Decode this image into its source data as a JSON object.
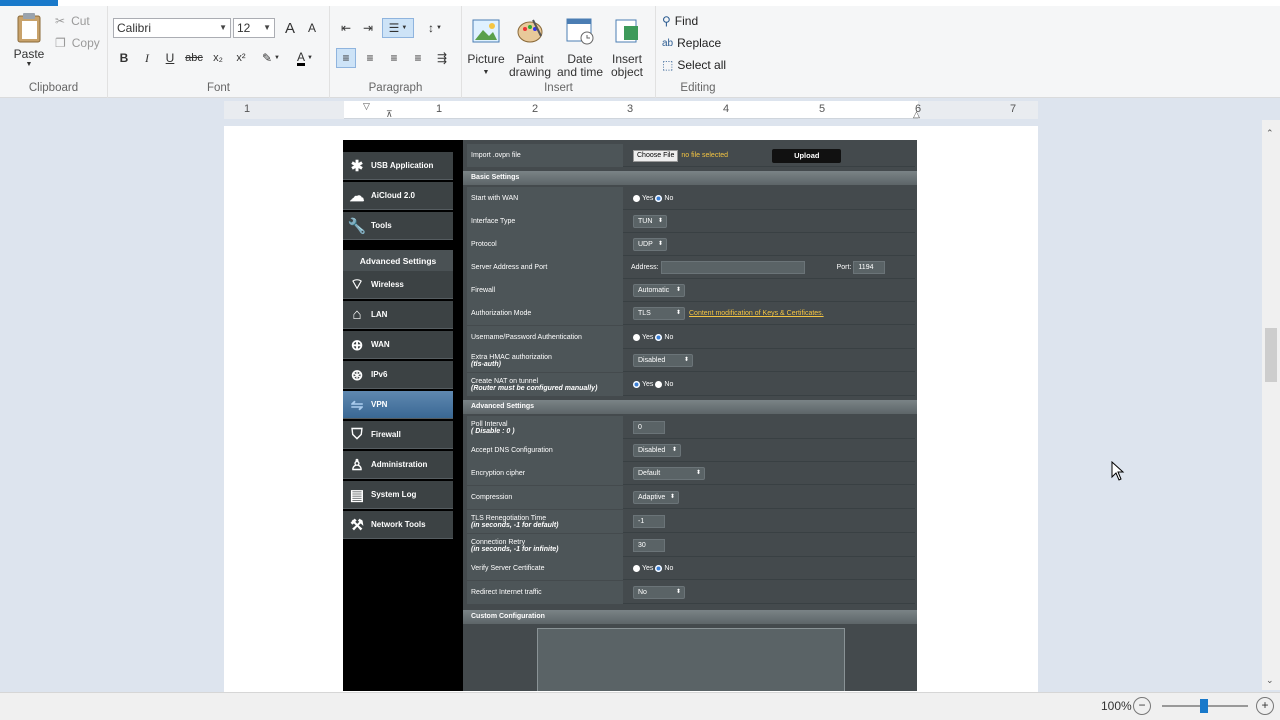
{
  "ribbon": {
    "clipboard": {
      "paste": "Paste",
      "cut": "Cut",
      "copy": "Copy",
      "label": "Clipboard"
    },
    "font": {
      "family": "Calibri",
      "size": "12",
      "label": "Font"
    },
    "paragraph": {
      "label": "Paragraph"
    },
    "insert": {
      "picture": "Picture",
      "paint": "Paint drawing",
      "datetime": "Date and time",
      "object": "Insert object",
      "label": "Insert"
    },
    "editing": {
      "find": "Find",
      "replace": "Replace",
      "selectall": "Select all",
      "label": "Editing"
    }
  },
  "ruler": {
    "numbers": [
      "1",
      "1",
      "2",
      "3",
      "4",
      "5",
      "6",
      "7"
    ]
  },
  "router": {
    "nav_top": [
      "USB Application",
      "AiCloud 2.0",
      "Tools"
    ],
    "adv_header": "Advanced Settings",
    "nav_adv": [
      "Wireless",
      "LAN",
      "WAN",
      "IPv6",
      "VPN",
      "Firewall",
      "Administration",
      "System Log",
      "Network Tools"
    ],
    "import": {
      "label": "Import .ovpn file",
      "choose": "Choose File",
      "nofile": "no file selected",
      "upload": "Upload"
    },
    "basic_header": "Basic Settings",
    "basic": [
      {
        "label": "Start with WAN",
        "yes": "Yes",
        "no": "No"
      },
      {
        "label": "Interface Type",
        "value": "TUN"
      },
      {
        "label": "Protocol",
        "value": "UDP"
      },
      {
        "label": "Server Address and Port",
        "address": "Address:",
        "port": "Port:",
        "port_value": "1194"
      },
      {
        "label": "Firewall",
        "value": "Automatic"
      },
      {
        "label": "Authorization Mode",
        "value": "TLS",
        "link": "Content modification of Keys & Certificates."
      },
      {
        "label": "Username/Password Authentication",
        "yes": "Yes",
        "no": "No"
      },
      {
        "label": "Extra HMAC authorization",
        "sub": "(tls-auth)",
        "value": "Disabled"
      },
      {
        "label": "Create NAT on tunnel",
        "sub": "(Router must be configured manually)",
        "yes": "Yes",
        "no": "No"
      }
    ],
    "adv_settings_header": "Advanced Settings",
    "adv": [
      {
        "label": "Poll Interval",
        "sub": "( Disable : 0 )",
        "value": "0"
      },
      {
        "label": "Accept DNS Configuration",
        "value": "Disabled"
      },
      {
        "label": "Encryption cipher",
        "value": "Default"
      },
      {
        "label": "Compression",
        "value": "Adaptive"
      },
      {
        "label": "TLS Renegotiation Time",
        "sub": "(in seconds, -1 for default)",
        "value": "-1"
      },
      {
        "label": "Connection Retry",
        "sub": "(in seconds, -1 for infinite)",
        "value": "30"
      },
      {
        "label": "Verify Server Certificate",
        "yes": "Yes",
        "no": "No"
      },
      {
        "label": "Redirect Internet traffic",
        "value": "No"
      }
    ],
    "custom_header": "Custom Configuration"
  },
  "status": {
    "zoom": "100%",
    "minus": "−",
    "plus": "+"
  }
}
